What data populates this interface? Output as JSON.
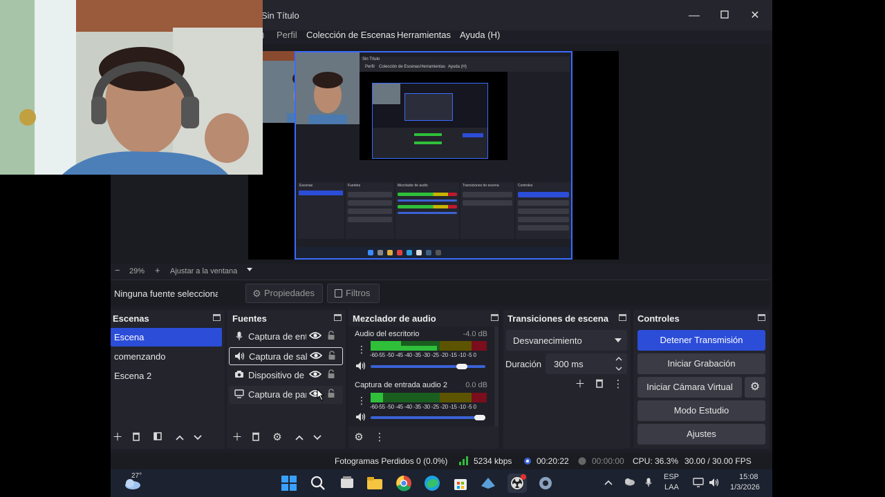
{
  "window": {
    "title": "Sin Título"
  },
  "menu": [
    "Perfil",
    "Colección de Escenas",
    "Herramientas",
    "Ayuda (H)"
  ],
  "zoom": {
    "value": "29%",
    "fit_label": "Ajustar a la ventana",
    "minus": "−",
    "plus": "+"
  },
  "properties_bar": {
    "no_source": "Ninguna fuente seleccionada",
    "properties": "Propiedades",
    "filters": "Filtros"
  },
  "scenes": {
    "title": "Escenas",
    "items": [
      "Escena",
      "comenzando",
      "Escena 2"
    ],
    "selected": 0
  },
  "sources": {
    "title": "Fuentes",
    "items": [
      {
        "label": "Captura de entrada audio",
        "icon": "microphone-icon"
      },
      {
        "label": "Captura de salida audio",
        "icon": "speaker-icon"
      },
      {
        "label": "Dispositivo de captura de video",
        "icon": "camera-icon"
      },
      {
        "label": "Captura de pantalla",
        "icon": "monitor-icon"
      }
    ]
  },
  "mixer": {
    "title": "Mezclador de audio",
    "scale": "-60-55 -50 -45 -40 -35 -30 -25 -20 -15 -10 -5 0",
    "channels": [
      {
        "name": "Audio del escritorio",
        "db": "-4.0 dB",
        "volume": 0.8
      },
      {
        "name": "Captura de entrada audio 2",
        "db": "0.0 dB",
        "volume": 1.0
      }
    ]
  },
  "transitions": {
    "title": "Transiciones de escena",
    "selected": "Desvanecimiento",
    "duration_label": "Duración",
    "duration_value": "300 ms"
  },
  "controls": {
    "title": "Controles",
    "stop_stream": "Detener Transmisión",
    "start_recording": "Iniciar Grabación",
    "virtual_cam": "Iniciar Cámara Virtual",
    "studio_mode": "Modo Estudio",
    "settings": "Ajustes"
  },
  "status": {
    "dropped_frames": "Fotogramas Perdidos 0 (0.0%)",
    "bitrate": "5234 kbps",
    "stream_time": "00:20:22",
    "rec_time": "00:00:00",
    "cpu": "CPU: 36.3%",
    "fps": "30.00 / 30.00 FPS"
  },
  "taskbar": {
    "weather": "27°",
    "lang": "ESP",
    "lang2": "LAA",
    "time": "15:08",
    "date": "1/3/2026"
  },
  "colors": {
    "accent": "#2c4dd8",
    "meter_green": "#2fbf3a",
    "meter_yellow": "#c8b400",
    "meter_red": "#c0182e"
  }
}
